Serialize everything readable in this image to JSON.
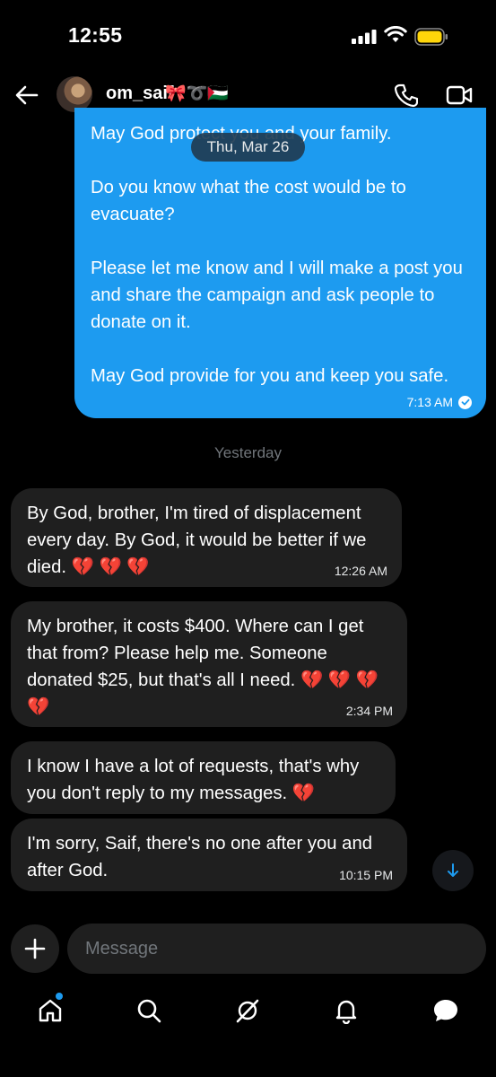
{
  "status_bar": {
    "time": "12:55"
  },
  "header": {
    "username": "om_saif",
    "name_emojis": "🎀➰🇵🇸",
    "icons": [
      "back-arrow-icon",
      "phone-icon",
      "video-icon"
    ]
  },
  "conversation": {
    "date_pill": "Thu, Mar 26",
    "sent_message": {
      "paragraphs": [
        "May God protect you and your family.",
        "Do you know what the cost would be to evacuate?",
        "Please let me know and I will make a post you and share the campaign and ask people to donate on it.",
        "May God provide for you and keep you safe."
      ],
      "time": "7:13 AM",
      "status": "read"
    },
    "day_separator": "Yesterday",
    "received_messages": [
      {
        "text": "By God, brother, I'm tired of displacement every day. By God, it would be better if we died. 💔 💔 💔",
        "time": "12:26 AM"
      },
      {
        "text": "My brother, it costs $400. Where can I get that from? Please help me. Someone donated $25, but that's all I need. 💔 💔 💔 💔",
        "time": "2:34 PM"
      },
      {
        "text": "I know I have a lot of requests, that's why you don't reply to my messages. 💔",
        "time": ""
      },
      {
        "text": "I'm sorry, Saif, there's no one after you and after God.",
        "time": "10:15 PM"
      }
    ]
  },
  "composer": {
    "placeholder": "Message"
  },
  "bottom_nav": {
    "items": [
      "home-icon",
      "search-icon",
      "grok-icon",
      "notifications-icon",
      "messages-icon"
    ],
    "active": "messages-icon",
    "accent": "#1d9bf0"
  },
  "colors": {
    "sent_bubble": "#1d9bf0",
    "received_bubble": "#1f1f1f",
    "background": "#000000"
  }
}
